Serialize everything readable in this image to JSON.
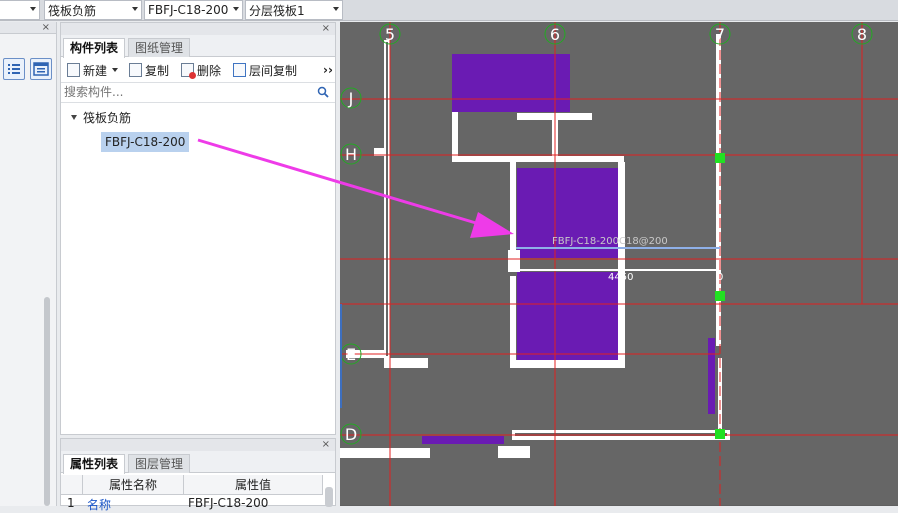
{
  "topbar": {
    "combo_type_value": "筏板负筋",
    "combo_name_value": "FBFJ-C18-200",
    "combo_layer_value": "分层筏板1"
  },
  "component_panel": {
    "tabs": [
      "构件列表",
      "图纸管理"
    ],
    "toolbar": {
      "new_label": "新建",
      "copy_label": "复制",
      "delete_label": "删除",
      "floor_copy_label": "层间复制",
      "more": "››"
    },
    "search_placeholder": "搜索构件...",
    "tree": {
      "root_label": "筏板负筋",
      "item_label": "FBFJ-C18-200"
    }
  },
  "property_panel": {
    "tabs": [
      "属性列表",
      "图层管理"
    ],
    "headers": [
      "属性名称",
      "属性值"
    ],
    "rows": [
      {
        "index": "1",
        "name": "名称",
        "value": "FBFJ-C18-200"
      }
    ]
  },
  "canvas": {
    "axis_labels": {
      "c5": "5",
      "c6": "6",
      "c7": "7",
      "c8": "8",
      "rJ": "J",
      "rH": "H",
      "rE": "E",
      "rD": "D"
    },
    "rebar_label": "FBFJ-C18-200C18@200",
    "dim_left": "4450",
    "dim_right": "0",
    "colors": {
      "background": "#666666",
      "wall": "#ffffff",
      "slab": "#6a1bb3",
      "axis": "#e02020",
      "column": "#22e022",
      "arrow": "#ee3be8"
    }
  }
}
